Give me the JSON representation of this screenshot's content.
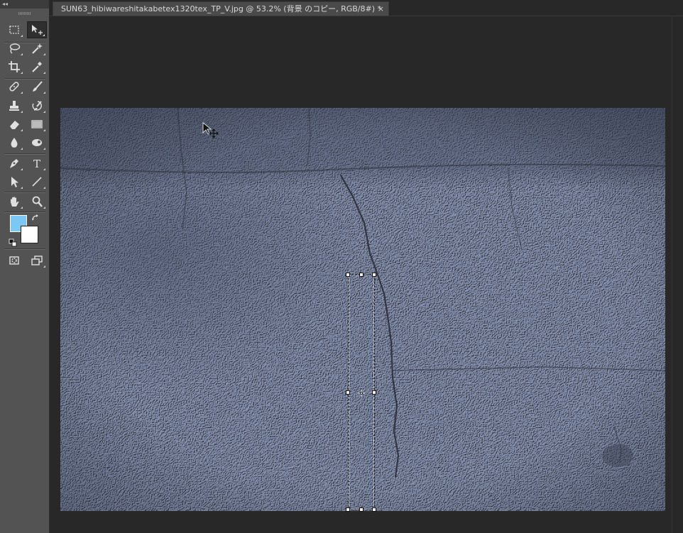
{
  "toolbar": {
    "collapse_label": "◂◂",
    "tools": [
      {
        "name": "rectangular-marquee-tool-icon",
        "row": 0,
        "col": 0
      },
      {
        "name": "move-tool-icon",
        "row": 0,
        "col": 1,
        "selected": true
      },
      {
        "name": "lasso-tool-icon",
        "row": 1,
        "col": 0
      },
      {
        "name": "magic-wand-tool-icon",
        "row": 1,
        "col": 1
      },
      {
        "name": "crop-tool-icon",
        "row": 2,
        "col": 0
      },
      {
        "name": "eyedropper-tool-icon",
        "row": 2,
        "col": 1
      },
      {
        "name": "spot-healing-brush-tool-icon",
        "row": 3,
        "col": 0
      },
      {
        "name": "brush-tool-icon",
        "row": 3,
        "col": 1
      },
      {
        "name": "clone-stamp-tool-icon",
        "row": 4,
        "col": 0
      },
      {
        "name": "history-brush-tool-icon",
        "row": 4,
        "col": 1
      },
      {
        "name": "eraser-tool-icon",
        "row": 5,
        "col": 0
      },
      {
        "name": "gradient-tool-icon",
        "row": 5,
        "col": 1
      },
      {
        "name": "blur-tool-icon",
        "row": 6,
        "col": 0
      },
      {
        "name": "dodge-tool-icon",
        "row": 6,
        "col": 1
      },
      {
        "name": "pen-tool-icon",
        "row": 7,
        "col": 0
      },
      {
        "name": "type-tool-icon",
        "row": 7,
        "col": 1,
        "glyph": "T"
      },
      {
        "name": "path-selection-tool-icon",
        "row": 8,
        "col": 0
      },
      {
        "name": "line-tool-icon",
        "row": 8,
        "col": 1
      },
      {
        "name": "hand-tool-icon",
        "row": 9,
        "col": 0
      },
      {
        "name": "zoom-tool-icon",
        "row": 9,
        "col": 1
      }
    ],
    "foreground_color": "#7cc8f4",
    "background_color": "#ffffff"
  },
  "document": {
    "tab_title": "SUN63_hibiwareshitakabetex1320tex_TP_V.jpg @ 53.2% (背景 のコピー, RGB/8#) *",
    "close_glyph": "×",
    "texture_base_color": "#a4adc4",
    "texture_dark_color": "#5b6275",
    "crack_color": "#2b2f3a"
  },
  "colors": {
    "workspace": "#282828",
    "panel": "#535353",
    "tab": "#4a4a4a"
  }
}
